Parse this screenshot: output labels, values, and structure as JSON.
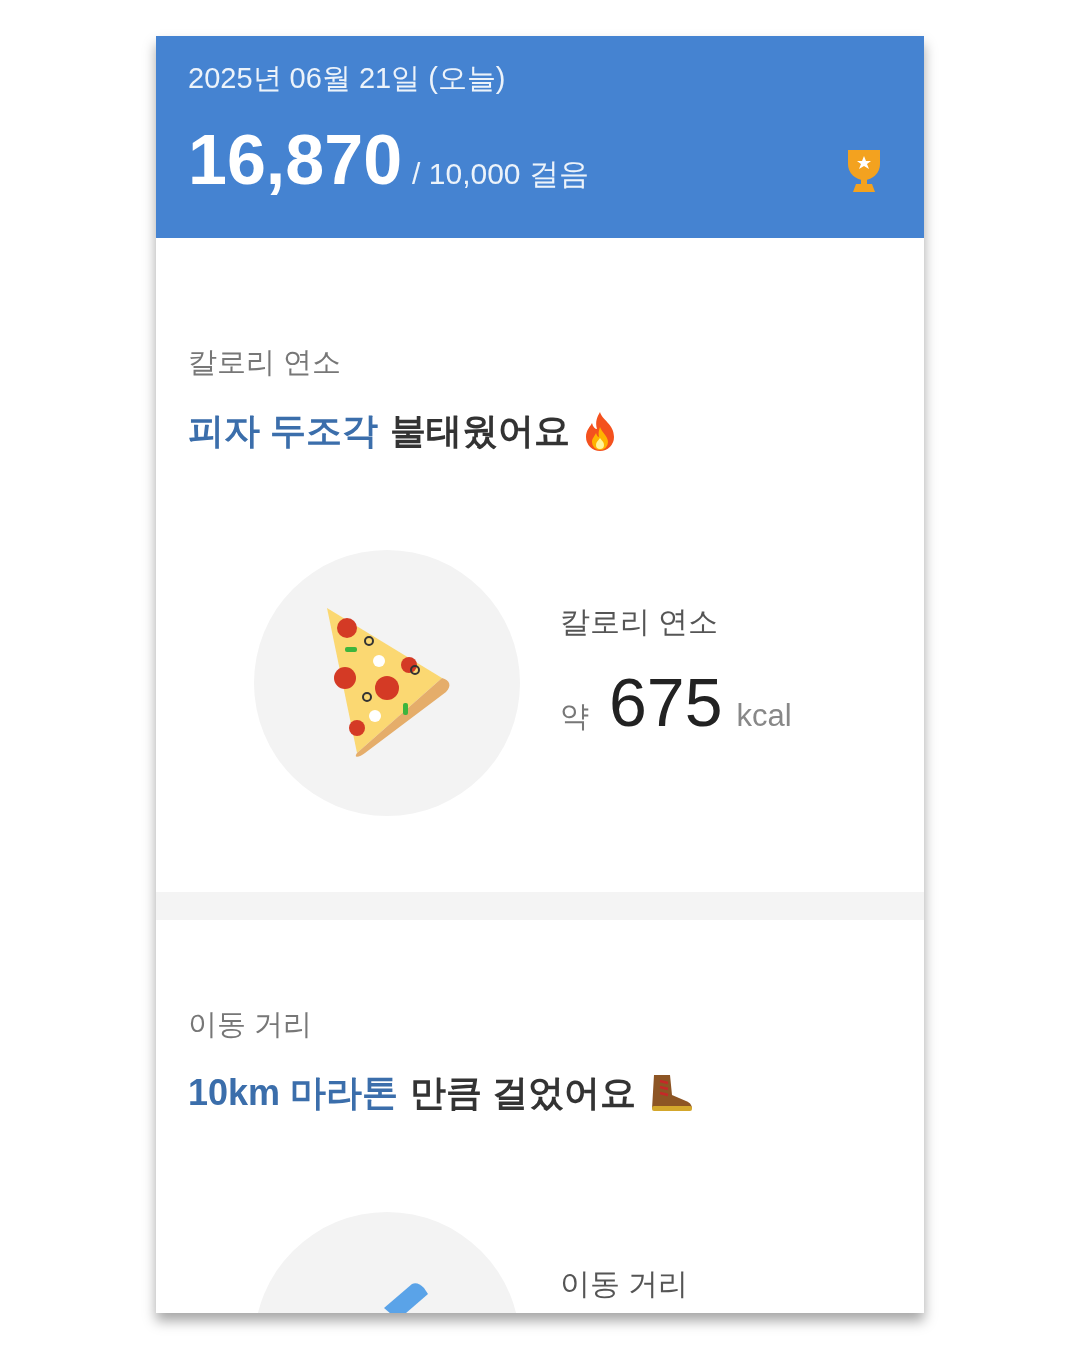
{
  "header": {
    "date": "2025년 06월 21일 (오늘)",
    "steps": "16,870",
    "goal": "/ 10,000 걸음",
    "goal_reached": true
  },
  "sections": [
    {
      "label": "칼로리 연소",
      "headline_highlight": "피자 두조각",
      "headline_rest": "불태웠어요",
      "kind": "calories",
      "stat_label": "칼로리 연소",
      "stat_prefix": "약",
      "stat_value": "675",
      "stat_unit": "kcal"
    },
    {
      "label": "이동 거리",
      "headline_highlight": "10km 마라톤",
      "headline_rest": "만큼 걸었어요",
      "kind": "distance",
      "stat_label": "이동 거리"
    }
  ]
}
